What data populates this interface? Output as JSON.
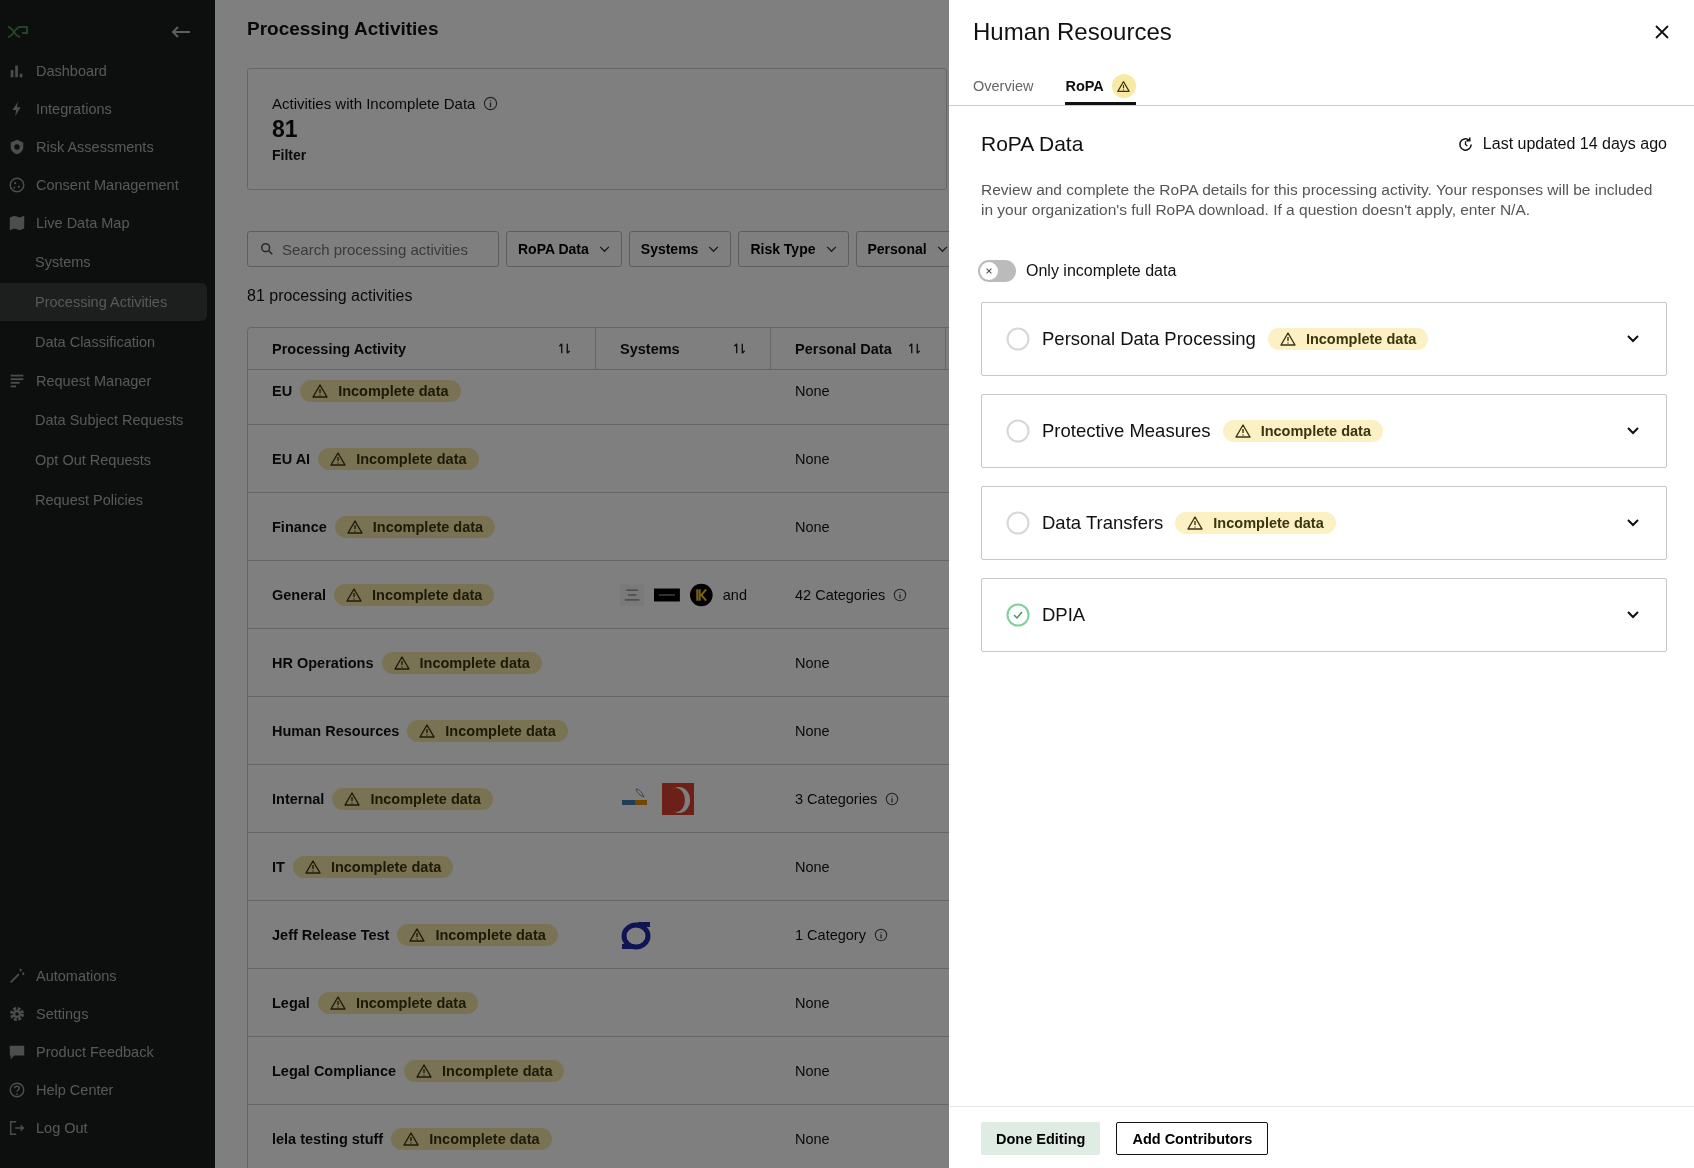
{
  "sidebar": {
    "items": [
      {
        "label": "Dashboard",
        "kind": "bars",
        "selected": false
      },
      {
        "label": "Integrations",
        "kind": "bolt",
        "selected": false
      },
      {
        "label": "Risk Assessments",
        "kind": "shield",
        "selected": false
      },
      {
        "label": "Consent Management",
        "kind": "cookie",
        "selected": false
      },
      {
        "label": "Live Data Map",
        "kind": "map",
        "selected": false,
        "children": [
          {
            "label": "Systems",
            "selected": false
          },
          {
            "label": "Processing Activities",
            "selected": true
          },
          {
            "label": "Data Classification",
            "selected": false
          }
        ]
      },
      {
        "label": "Request Manager",
        "kind": "list",
        "selected": false,
        "children": [
          {
            "label": "Data Subject Requests",
            "selected": false
          },
          {
            "label": "Opt Out Requests",
            "selected": false
          },
          {
            "label": "Request Policies",
            "selected": false
          }
        ]
      }
    ],
    "bottom_items": [
      {
        "label": "Automations",
        "kind": "wand"
      },
      {
        "label": "Settings",
        "kind": "gear"
      },
      {
        "label": "Product Feedback",
        "kind": "chat"
      },
      {
        "label": "Help Center",
        "kind": "help"
      },
      {
        "label": "Log Out",
        "kind": "logout"
      }
    ]
  },
  "main": {
    "title": "Processing Activities",
    "summary": {
      "label": "Activities with Incomplete Data",
      "value": "81",
      "link": "Filter"
    },
    "search": {
      "placeholder": "Search processing activities"
    },
    "filters": [
      "RoPA Data",
      "Systems",
      "Risk Type",
      "Personal"
    ],
    "count": "81 processing activities",
    "table": {
      "columns": [
        "Processing Activity",
        "Systems",
        "Personal Data"
      ],
      "rows": [
        {
          "name": "EU",
          "badge": "Incomplete data",
          "systems": [],
          "personal_data": "None",
          "info": false
        },
        {
          "name": "EU AI",
          "badge": "Incomplete data",
          "systems": [],
          "personal_data": "None",
          "info": false
        },
        {
          "name": "Finance",
          "badge": "Incomplete data",
          "systems": [],
          "personal_data": "None",
          "info": false
        },
        {
          "name": "General",
          "badge": "Incomplete data",
          "systems": [
            {
              "kind": "blank"
            },
            {
              "kind": "dark-bar"
            },
            {
              "kind": "yellow-circle"
            }
          ],
          "more": "and",
          "personal_data": "42 Categories",
          "info": true
        },
        {
          "name": "HR Operations",
          "badge": "Incomplete data",
          "systems": [],
          "personal_data": "None",
          "info": false
        },
        {
          "name": "Human Resources",
          "badge": "Incomplete data",
          "systems": [],
          "personal_data": "None",
          "info": false
        },
        {
          "name": "Internal",
          "badge": "Incomplete data",
          "systems": [
            {
              "kind": "dolphin"
            },
            {
              "kind": "red-square"
            }
          ],
          "personal_data": "3 Categories",
          "info": true
        },
        {
          "name": "IT",
          "badge": "Incomplete data",
          "systems": [],
          "personal_data": "None",
          "info": false
        },
        {
          "name": "Jeff Release Test",
          "badge": "Incomplete data",
          "systems": [
            {
              "kind": "blue-ring"
            }
          ],
          "personal_data": "1 Category",
          "info": true
        },
        {
          "name": "Legal",
          "badge": "Incomplete data",
          "systems": [],
          "personal_data": "None",
          "info": false
        },
        {
          "name": "Legal Compliance",
          "badge": "Incomplete data",
          "systems": [],
          "personal_data": "None",
          "info": false
        },
        {
          "name": "lela testing stuff",
          "badge": "Incomplete data",
          "systems": [],
          "personal_data": "None",
          "info": false
        }
      ]
    }
  },
  "drawer": {
    "title": "Human Resources",
    "tabs": [
      {
        "label": "Overview",
        "selected": false,
        "warning": false
      },
      {
        "label": "RoPA",
        "selected": true,
        "warning": true
      }
    ],
    "section_title": "RoPA Data",
    "last_updated": "Last updated 14 days ago",
    "description": "Review and complete the RoPA details for this processing activity. Your responses will be included in your organization's full RoPA download. If a question doesn't apply, enter N/A.",
    "toggle": {
      "label": "Only incomplete data",
      "on": false
    },
    "sections": [
      {
        "title": "Personal Data Processing",
        "complete": false,
        "badge": "Incomplete data"
      },
      {
        "title": "Protective Measures",
        "complete": false,
        "badge": "Incomplete data"
      },
      {
        "title": "Data Transfers",
        "complete": false,
        "badge": "Incomplete data"
      },
      {
        "title": "DPIA",
        "complete": true
      }
    ],
    "buttons": [
      {
        "label": "Done Editing",
        "kind": "primary"
      },
      {
        "label": "Add Contributors",
        "kind": "outline"
      }
    ]
  }
}
